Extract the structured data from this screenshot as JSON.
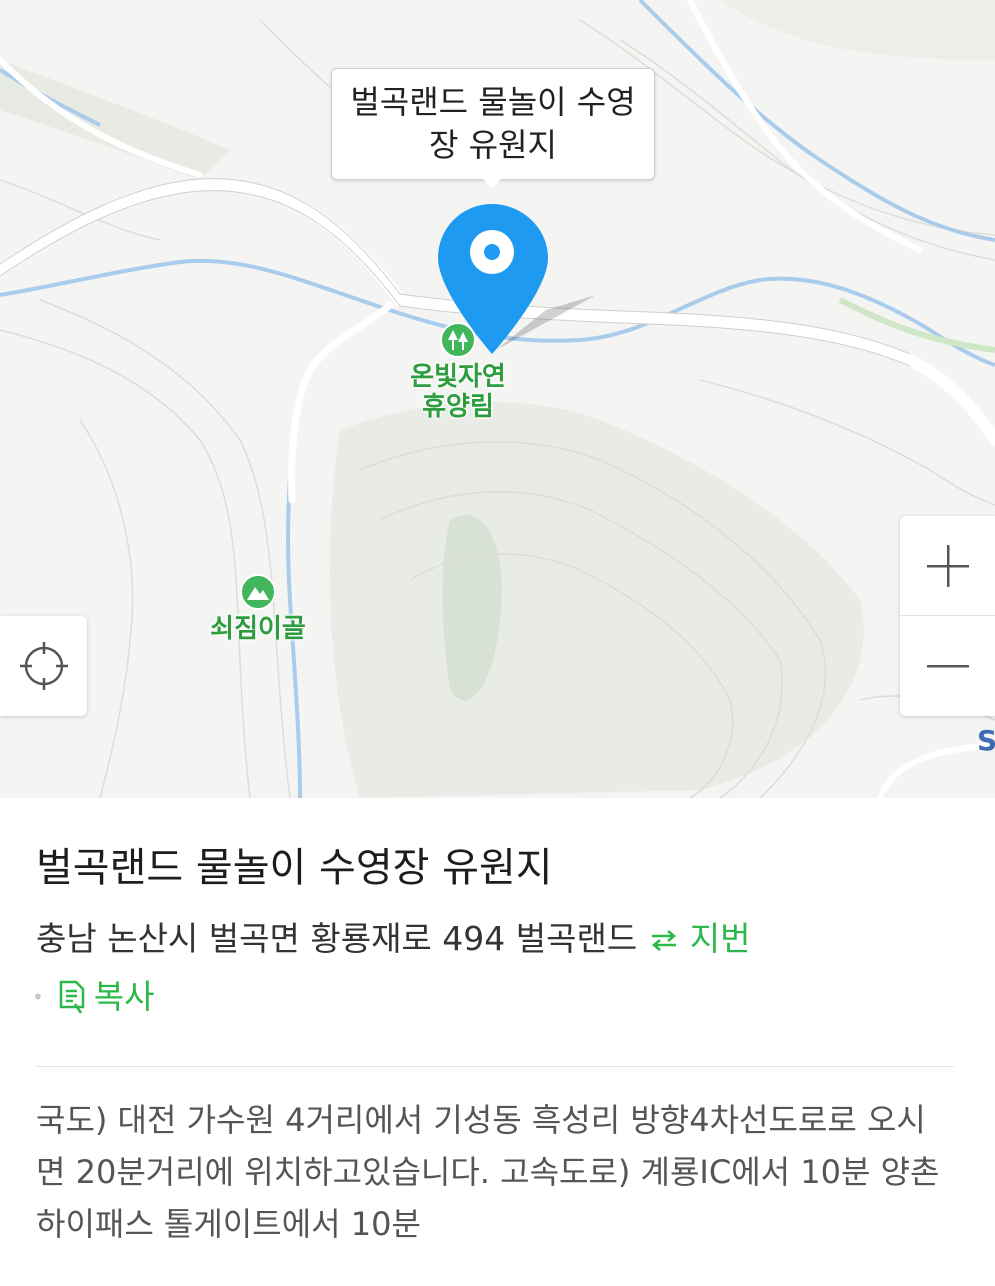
{
  "place": {
    "callout_label": "벌곡랜드 물놀이 수영장 유원지",
    "title": "벌곡랜드 물놀이 수영장 유원지",
    "address": "충남 논산시 벌곡면 황룡재로 494 벌곡랜드",
    "jibun_label": "지번",
    "copy_label": "복사",
    "directions": "국도) 대전 가수원 4거리에서 기성동 흑성리 방향4차선도로로 오시면 20분거리에 위치하고있습니다. 고속도로) 계룡IC에서 10분 양촌 하이패스 톨게이트에서 10분"
  },
  "map": {
    "pois": [
      {
        "label": "온빛자연 휴양림",
        "icon": "forest-icon"
      },
      {
        "label": "쇠짐이골",
        "icon": "mountain-icon"
      }
    ],
    "edge_label": "S",
    "controls": {
      "zoom_in_icon": "plus-icon",
      "zoom_out_icon": "minus-icon",
      "locate_icon": "crosshair-icon"
    }
  },
  "colors": {
    "accent_green": "#2db84a",
    "pin_blue": "#1e9bf0",
    "poi_green": "#41b65a"
  }
}
